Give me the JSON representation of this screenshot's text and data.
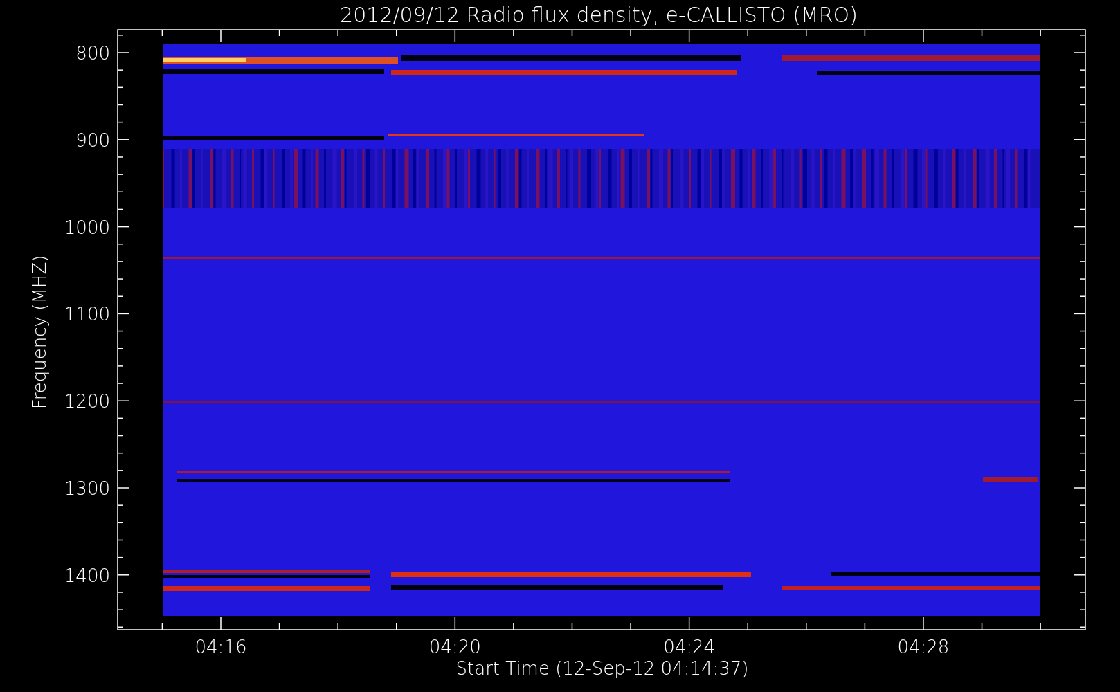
{
  "title": "2012/09/12  Radio flux density, e-CALLISTO (MRO)",
  "y_axis": {
    "label": "Frequency (MHZ)",
    "ticks": [
      "800",
      "900",
      "1000",
      "1100",
      "1200",
      "1300",
      "1400"
    ]
  },
  "x_axis": {
    "label": "Start Time (12-Sep-12 04:14:37)",
    "ticks": [
      "04:16",
      "04:20",
      "04:24",
      "04:28"
    ]
  }
}
